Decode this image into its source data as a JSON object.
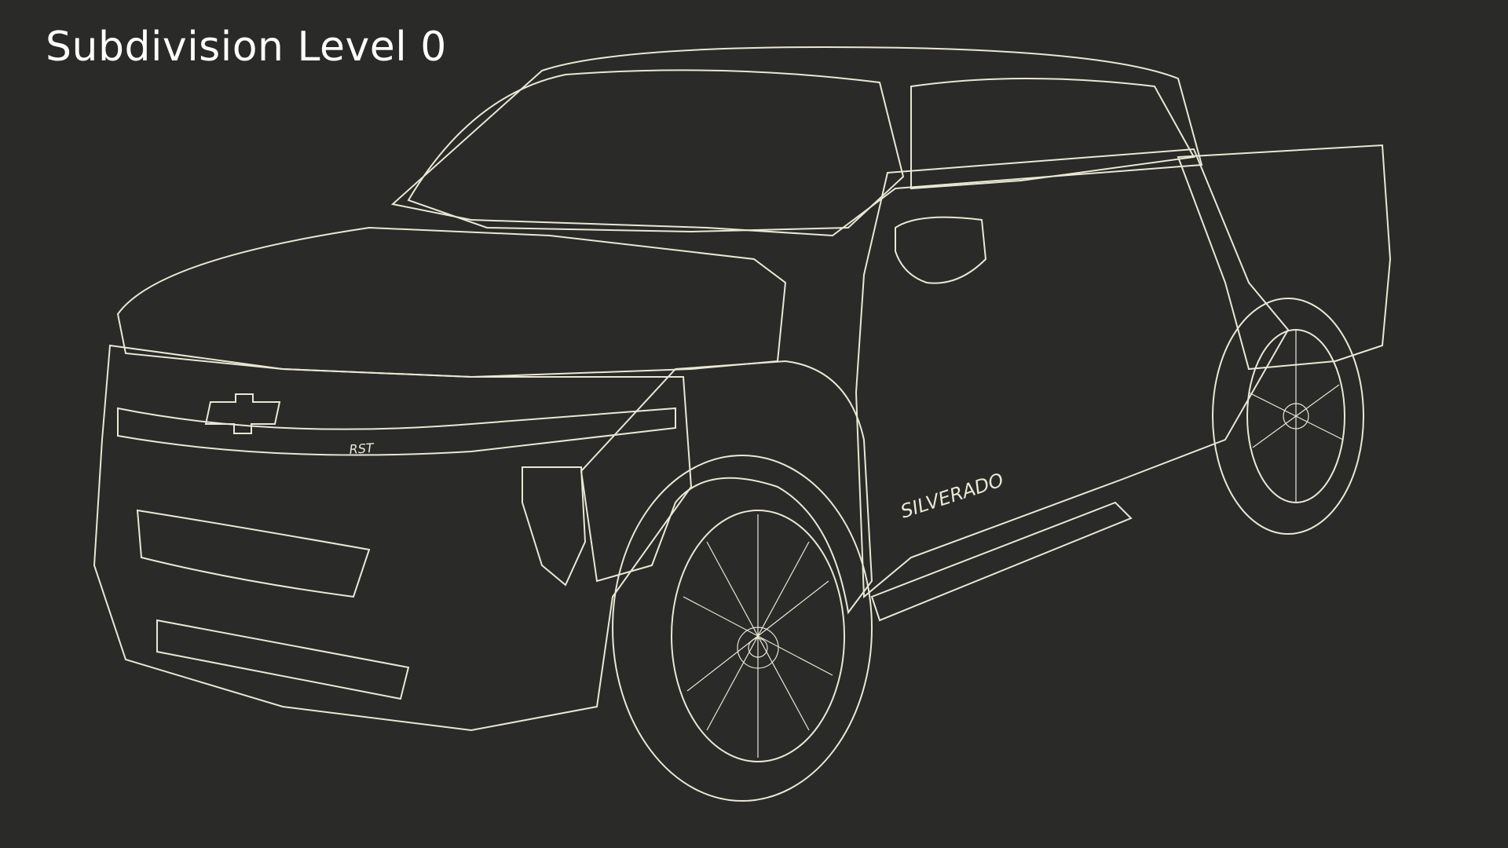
{
  "viewport": {
    "caption": "Subdivision Level 0",
    "background_color": "#2a2a28",
    "mesh_fill_color": "#7d7d6d",
    "wire_color": "#e8e8d4"
  },
  "model": {
    "badge_text": "SILVERADO",
    "trim_text": "RST"
  }
}
